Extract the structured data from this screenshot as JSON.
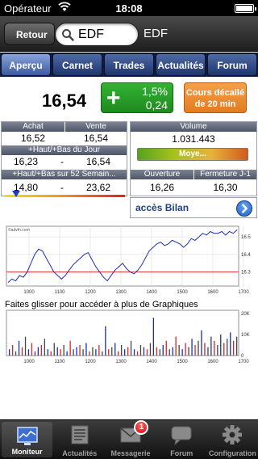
{
  "status_bar": {
    "carrier": "Opérateur",
    "time": "18:08"
  },
  "nav": {
    "back_label": "Retour",
    "search_value": "EDF",
    "title": "EDF"
  },
  "tabs": [
    {
      "label": "Aperçu",
      "active": true
    },
    {
      "label": "Carnet",
      "active": false
    },
    {
      "label": "Trades",
      "active": false
    },
    {
      "label": "Actualités",
      "active": false
    },
    {
      "label": "Forum",
      "active": false
    }
  ],
  "quote": {
    "price": "16,54",
    "change_sign": "+",
    "change_pct": "1,5%",
    "change_abs": "0,24",
    "delay_notice": "Cours décallé de 20 min"
  },
  "panels": {
    "achat_label": "Achat",
    "vente_label": "Vente",
    "achat": "16,52",
    "vente": "16,54",
    "day_range_label": "+Haut/+Bas du Jour",
    "day_low": "16,23",
    "day_high": "16,54",
    "day_sep": "-",
    "week52_label": "+Haut/+Bas sur 52 Semain...",
    "week52_low": "14,80",
    "week52_high": "23,62",
    "week52_sep": "-",
    "week52_position": 0.1,
    "volume_label": "Volume",
    "volume": "1.031.443",
    "volume_gauge_label": "Moye...",
    "ouverture_label": "Ouverture",
    "fermeture_label": "Fermeture J-1",
    "ouverture": "16,26",
    "fermeture": "16,30"
  },
  "bilan": {
    "label": "accès Bilan"
  },
  "chart_data": [
    {
      "type": "line",
      "source_label": "©advfn.com",
      "x_ticks": [
        "1000",
        "1100",
        "1200",
        "1300",
        "1400",
        "1500",
        "1600",
        "1700"
      ],
      "y_ticks": [
        "16.5",
        "16.4",
        "16.3"
      ],
      "ylim": [
        16.22,
        16.56
      ],
      "reference_line": 16.3,
      "series": [
        {
          "values": [
            16.24,
            16.26,
            16.25,
            16.28,
            16.27,
            16.3,
            16.35,
            16.4,
            16.43,
            16.42,
            16.38,
            16.34,
            16.3,
            16.28,
            16.26,
            16.28,
            16.31,
            16.34,
            16.36,
            16.38,
            16.4,
            16.41,
            16.37,
            16.33,
            16.3,
            16.27,
            16.25,
            16.28,
            16.31,
            16.33,
            16.35,
            16.32,
            16.3,
            16.29,
            16.31,
            16.34,
            16.38,
            16.42,
            16.44,
            16.46,
            16.47,
            16.45,
            16.46,
            16.48,
            16.47,
            16.46,
            16.44,
            16.46,
            16.49,
            16.48,
            16.5,
            16.52,
            16.51,
            16.53,
            16.52,
            16.52,
            16.53,
            16.51,
            16.53,
            16.52,
            16.54
          ]
        }
      ]
    },
    {
      "type": "bar",
      "title": "Faites glisser pour accéder à plus de Graphiques",
      "x_ticks": [
        "1000",
        "1100",
        "1200",
        "1300",
        "1400",
        "1500",
        "1600",
        "1700"
      ],
      "y_ticks": [
        "20K",
        "10K",
        "0"
      ],
      "series": [
        {
          "values": [
            3,
            5,
            2,
            7,
            4,
            9,
            3,
            6,
            2,
            4,
            5,
            8,
            3,
            2,
            6,
            4,
            3,
            5,
            2,
            7,
            3,
            4,
            5,
            3,
            6,
            2,
            4,
            3,
            5,
            2,
            14,
            3,
            4,
            6,
            2,
            5,
            3,
            4,
            7,
            3,
            2,
            5,
            4,
            3,
            6,
            18,
            4,
            3,
            5,
            7,
            3,
            4,
            9,
            5,
            3,
            6,
            4,
            8,
            5,
            7,
            12,
            6,
            4,
            9,
            7,
            5,
            10,
            6,
            8,
            11,
            7,
            9
          ]
        }
      ]
    }
  ],
  "tab_bar": [
    {
      "label": "Moniteur",
      "active": true,
      "icon": "monitor-icon"
    },
    {
      "label": "Actualités",
      "active": false,
      "icon": "newspaper-icon"
    },
    {
      "label": "Messagerie",
      "active": false,
      "icon": "envelope-icon",
      "badge": "1"
    },
    {
      "label": "Forum",
      "active": false,
      "icon": "speech-bubble-icon"
    },
    {
      "label": "Configuration",
      "active": false,
      "icon": "gear-icon"
    }
  ]
}
